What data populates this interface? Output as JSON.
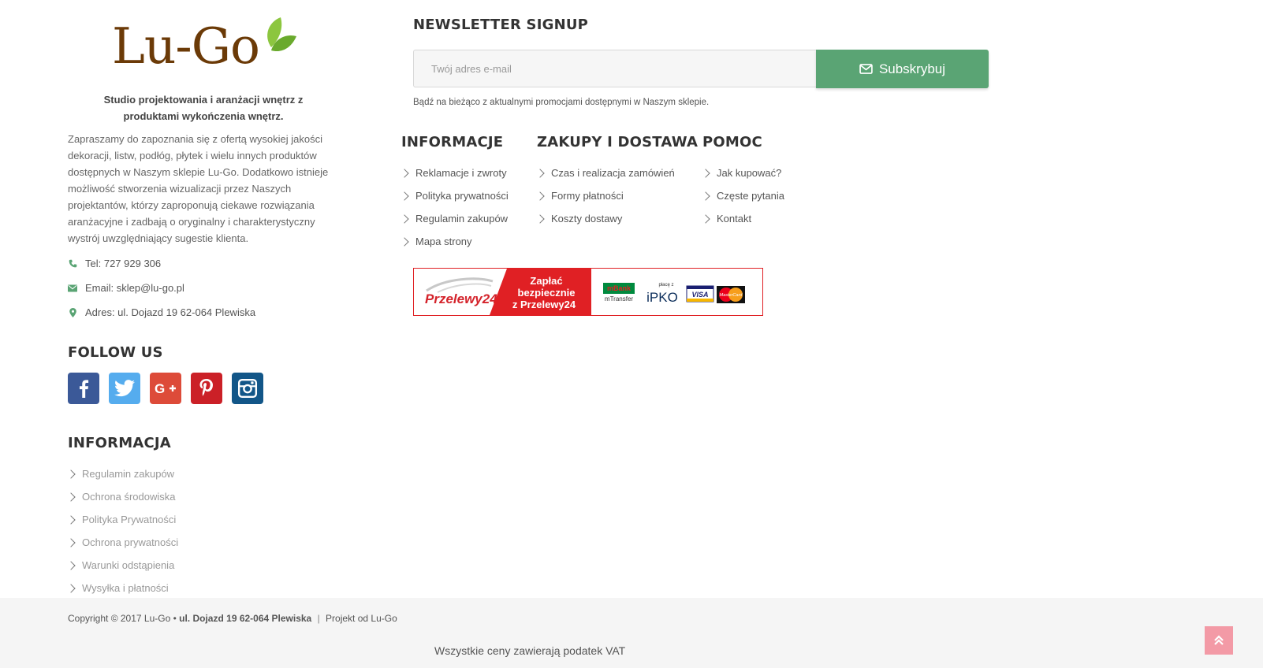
{
  "brand": {
    "logo_text": "Lu-Go",
    "tagline": "Studio projektowania i aranżacji wnętrz z produktami wykończenia wnętrz.",
    "about": "Zapraszamy do zapoznania się z ofertą wysokiej jakości dekoracji, listw, podłóg, płytek i wielu innych produktów dostępnych w Naszym sklepie Lu-Go. Dodatkowo istnieje możliwość stworzenia wizualizacji przez Naszych projektantów, którzy zaproponują ciekawe rozwiązania aranżacyjne i zadbają o oryginalny i charakterystyczny wystrój uwzględniający sugestie klienta."
  },
  "contact": {
    "phone": "Tel: 727 929 306",
    "email": "Email: sklep@lu-go.pl",
    "address": "Adres: ul. Dojazd 19 62-064 Plewiska"
  },
  "follow": {
    "title": "FOLLOW US",
    "networks": [
      "facebook-icon",
      "twitter-icon",
      "google-plus-icon",
      "pinterest-icon",
      "instagram-icon"
    ],
    "colors": {
      "facebook": "#3b5998",
      "twitter": "#55acee",
      "google": "#dd4b39",
      "pinterest": "#cb2027",
      "instagram": "#125688"
    }
  },
  "informacja_left": {
    "title": "INFORMACJA",
    "items": [
      "Regulamin zakupów",
      "Ochrona środowiska",
      "Polityka Prywatności",
      "Ochrona prywatności",
      "Warunki odstąpienia",
      "Wysyłka i płatności"
    ]
  },
  "newsletter": {
    "title": "NEWSLETTER SIGNUP",
    "placeholder": "Twój adres e-mail",
    "button": "Subskrybuj",
    "note": "Bądź na bieżąco z aktualnymi promocjami dostępnymi w Naszym sklepie."
  },
  "columns": [
    {
      "title": "INFORMACJE",
      "items": [
        "Reklamacje i zwroty",
        "Polityka prywatności",
        "Regulamin zakupów",
        "Mapa strony"
      ]
    },
    {
      "title": "ZAKUPY I DOSTAWA",
      "items": [
        "Czas i realizacja zamówień",
        "Formy płatności",
        "Koszty dostawy"
      ]
    },
    {
      "title": "POMOC",
      "items": [
        "Jak kupować?",
        "Częste pytania",
        "Kontakt"
      ]
    }
  ],
  "payment": {
    "brand": "Przelewy24",
    "slogan_lines": [
      "Zapłać",
      "bezpiecznie",
      "z Przelewy24"
    ],
    "mbank": "mBank",
    "mtransfer": "mTransfer",
    "ipko_small": "płacę z",
    "ipko": "iPKO",
    "visa": "VISA",
    "mastercard": "MasterCard"
  },
  "footer": {
    "copyright": "Copyright © 2017 Lu-Go •",
    "address_bold": "ul. Dojazd 19 62-064 Plewiska",
    "separator": "|",
    "project": "Projekt od Lu-Go",
    "vat": "Wszystkie ceny zawierają podatek VAT"
  },
  "colors": {
    "accent": "#5aa474",
    "logo_brown": "#6b3a07",
    "to_top": "#f39aa6",
    "payment_red": "#e02024"
  }
}
